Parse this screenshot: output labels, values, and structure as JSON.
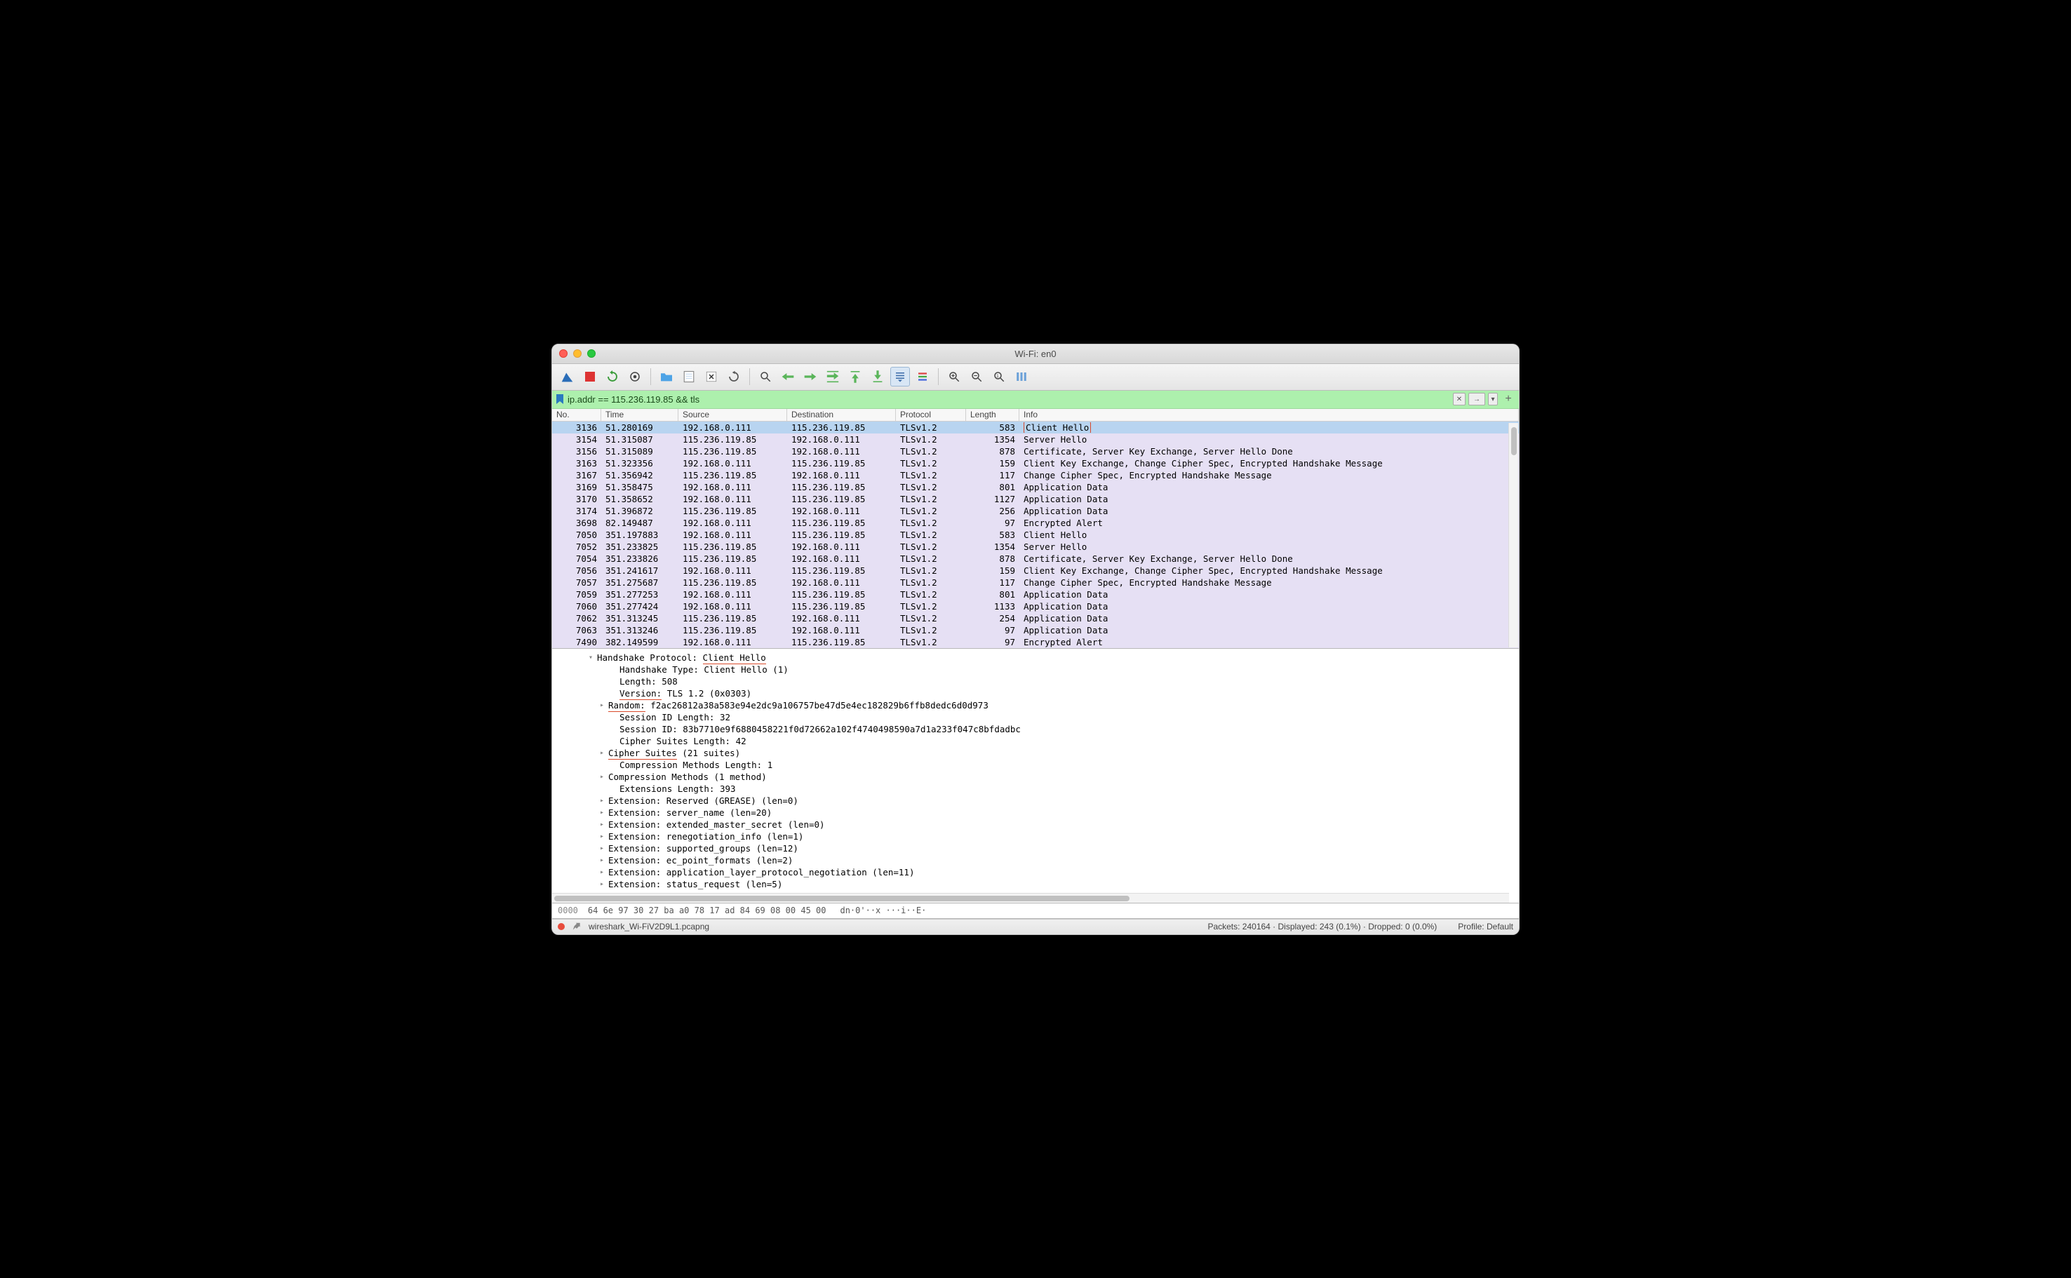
{
  "window_title": "Wi-Fi: en0",
  "filter_text": "ip.addr == 115.236.119.85 && tls",
  "columns": [
    "No.",
    "Time",
    "Source",
    "Destination",
    "Protocol",
    "Length",
    "Info"
  ],
  "packets": [
    {
      "no": "3136",
      "time": "51.280169",
      "src": "192.168.0.111",
      "dst": "115.236.119.85",
      "proto": "TLSv1.2",
      "len": "583",
      "info": "Client Hello",
      "selected": true,
      "info_boxed": true
    },
    {
      "no": "3154",
      "time": "51.315087",
      "src": "115.236.119.85",
      "dst": "192.168.0.111",
      "proto": "TLSv1.2",
      "len": "1354",
      "info": "Server Hello"
    },
    {
      "no": "3156",
      "time": "51.315089",
      "src": "115.236.119.85",
      "dst": "192.168.0.111",
      "proto": "TLSv1.2",
      "len": "878",
      "info": "Certificate, Server Key Exchange, Server Hello Done"
    },
    {
      "no": "3163",
      "time": "51.323356",
      "src": "192.168.0.111",
      "dst": "115.236.119.85",
      "proto": "TLSv1.2",
      "len": "159",
      "info": "Client Key Exchange, Change Cipher Spec, Encrypted Handshake Message"
    },
    {
      "no": "3167",
      "time": "51.356942",
      "src": "115.236.119.85",
      "dst": "192.168.0.111",
      "proto": "TLSv1.2",
      "len": "117",
      "info": "Change Cipher Spec, Encrypted Handshake Message"
    },
    {
      "no": "3169",
      "time": "51.358475",
      "src": "192.168.0.111",
      "dst": "115.236.119.85",
      "proto": "TLSv1.2",
      "len": "801",
      "info": "Application Data"
    },
    {
      "no": "3170",
      "time": "51.358652",
      "src": "192.168.0.111",
      "dst": "115.236.119.85",
      "proto": "TLSv1.2",
      "len": "1127",
      "info": "Application Data"
    },
    {
      "no": "3174",
      "time": "51.396872",
      "src": "115.236.119.85",
      "dst": "192.168.0.111",
      "proto": "TLSv1.2",
      "len": "256",
      "info": "Application Data"
    },
    {
      "no": "3698",
      "time": "82.149487",
      "src": "192.168.0.111",
      "dst": "115.236.119.85",
      "proto": "TLSv1.2",
      "len": "97",
      "info": "Encrypted Alert"
    },
    {
      "no": "7050",
      "time": "351.197883",
      "src": "192.168.0.111",
      "dst": "115.236.119.85",
      "proto": "TLSv1.2",
      "len": "583",
      "info": "Client Hello"
    },
    {
      "no": "7052",
      "time": "351.233825",
      "src": "115.236.119.85",
      "dst": "192.168.0.111",
      "proto": "TLSv1.2",
      "len": "1354",
      "info": "Server Hello"
    },
    {
      "no": "7054",
      "time": "351.233826",
      "src": "115.236.119.85",
      "dst": "192.168.0.111",
      "proto": "TLSv1.2",
      "len": "878",
      "info": "Certificate, Server Key Exchange, Server Hello Done"
    },
    {
      "no": "7056",
      "time": "351.241617",
      "src": "192.168.0.111",
      "dst": "115.236.119.85",
      "proto": "TLSv1.2",
      "len": "159",
      "info": "Client Key Exchange, Change Cipher Spec, Encrypted Handshake Message"
    },
    {
      "no": "7057",
      "time": "351.275687",
      "src": "115.236.119.85",
      "dst": "192.168.0.111",
      "proto": "TLSv1.2",
      "len": "117",
      "info": "Change Cipher Spec, Encrypted Handshake Message"
    },
    {
      "no": "7059",
      "time": "351.277253",
      "src": "192.168.0.111",
      "dst": "115.236.119.85",
      "proto": "TLSv1.2",
      "len": "801",
      "info": "Application Data"
    },
    {
      "no": "7060",
      "time": "351.277424",
      "src": "192.168.0.111",
      "dst": "115.236.119.85",
      "proto": "TLSv1.2",
      "len": "1133",
      "info": "Application Data"
    },
    {
      "no": "7062",
      "time": "351.313245",
      "src": "115.236.119.85",
      "dst": "192.168.0.111",
      "proto": "TLSv1.2",
      "len": "254",
      "info": "Application Data"
    },
    {
      "no": "7063",
      "time": "351.313246",
      "src": "115.236.119.85",
      "dst": "192.168.0.111",
      "proto": "TLSv1.2",
      "len": "97",
      "info": "Application Data"
    },
    {
      "no": "7490",
      "time": "382.149599",
      "src": "192.168.0.111",
      "dst": "115.236.119.85",
      "proto": "TLSv1.2",
      "len": "97",
      "info": "Encrypted Alert"
    }
  ],
  "details": [
    {
      "indent": 3,
      "arrow": "down",
      "text": "Handshake Protocol: ",
      "uline": "Client Hello"
    },
    {
      "indent": 5,
      "arrow": "",
      "text": "Handshake Type: Client Hello (1)"
    },
    {
      "indent": 5,
      "arrow": "",
      "text": "Length: 508"
    },
    {
      "indent": 5,
      "arrow": "",
      "text": "",
      "uline": "Version:",
      "after": " TLS 1.2 (0x0303)"
    },
    {
      "indent": 4,
      "arrow": "right",
      "text": "",
      "uline": "Random:",
      "after": " f2ac26812a38a583e94e2dc9a106757be47d5e4ec182829b6ffb8dedc6d0d973"
    },
    {
      "indent": 5,
      "arrow": "",
      "text": "Session ID Length: 32"
    },
    {
      "indent": 5,
      "arrow": "",
      "text": "Session ID: 83b7710e9f6880458221f0d72662a102f4740498590a7d1a233f047c8bfdadbc"
    },
    {
      "indent": 5,
      "arrow": "",
      "text": "Cipher Suites Length: 42"
    },
    {
      "indent": 4,
      "arrow": "right",
      "text": "",
      "uline": "Cipher Suites",
      "after": " (21 suites)"
    },
    {
      "indent": 5,
      "arrow": "",
      "text": "Compression Methods Length: 1"
    },
    {
      "indent": 4,
      "arrow": "right",
      "text": "Compression Methods (1 method)"
    },
    {
      "indent": 5,
      "arrow": "",
      "text": "Extensions Length: 393"
    },
    {
      "indent": 4,
      "arrow": "right",
      "text": "Extension: Reserved (GREASE) (len=0)"
    },
    {
      "indent": 4,
      "arrow": "right",
      "text": "Extension: server_name (len=20)"
    },
    {
      "indent": 4,
      "arrow": "right",
      "text": "Extension: extended_master_secret (len=0)"
    },
    {
      "indent": 4,
      "arrow": "right",
      "text": "Extension: renegotiation_info (len=1)"
    },
    {
      "indent": 4,
      "arrow": "right",
      "text": "Extension: supported_groups (len=12)"
    },
    {
      "indent": 4,
      "arrow": "right",
      "text": "Extension: ec_point_formats (len=2)"
    },
    {
      "indent": 4,
      "arrow": "right",
      "text": "Extension: application_layer_protocol_negotiation (len=11)"
    },
    {
      "indent": 4,
      "arrow": "right",
      "text": "Extension: status_request (len=5)"
    }
  ],
  "hex": {
    "offset": "0000",
    "bytes": "64 6e 97 30 27 ba a0 78   17 ad 84 69 08 00 45 00",
    "ascii": "dn·0'··x ···i··E·"
  },
  "statusbar": {
    "file": "wireshark_Wi-FiV2D9L1.pcapng",
    "stats": "Packets: 240164 · Displayed: 243 (0.1%) · Dropped: 0 (0.0%)",
    "profile": "Profile: Default"
  }
}
